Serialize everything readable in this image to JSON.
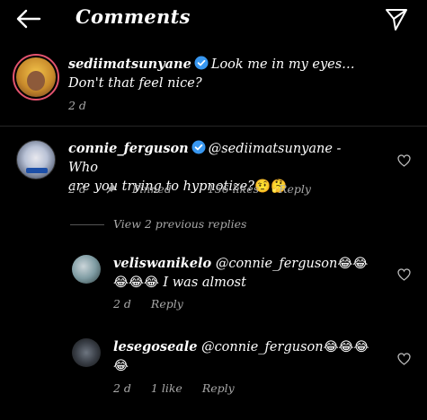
{
  "header": {
    "title": "Comments"
  },
  "caption": {
    "username": "sediimatsunyane",
    "text_line1": "Look me in my eyes…",
    "text_line2": "Don't that feel nice?",
    "time": "2 d"
  },
  "comments": [
    {
      "username": "connie_ferguson",
      "mention": "@sediimatsunyane",
      "text_a": " - Who",
      "text_b": "are you trying to hypnotize?",
      "emojis": "🤨🤔",
      "time": "2 d",
      "pinned": "Pinned",
      "likes": "156 likes",
      "reply": "Reply"
    }
  ],
  "view_previous": "View 2 previous replies",
  "replies": [
    {
      "username": "veliswanikelo",
      "mention": "@connie_ferguson",
      "emojis_line1": "😂😂",
      "emojis_line2": "😂😂😂",
      "text": " I was almost",
      "time": "2 d",
      "reply": "Reply"
    },
    {
      "username": "lesegoseale",
      "mention": "@connie_ferguson",
      "emojis_line1": "😂😂😂",
      "emojis_line2": "😂",
      "time": "2 d",
      "likes": "1 like",
      "reply": "Reply"
    }
  ],
  "colors": {
    "background": "#000000",
    "muted": "#a8a8a8",
    "verified": "#3897f0",
    "story_ring": "#e2536e"
  }
}
